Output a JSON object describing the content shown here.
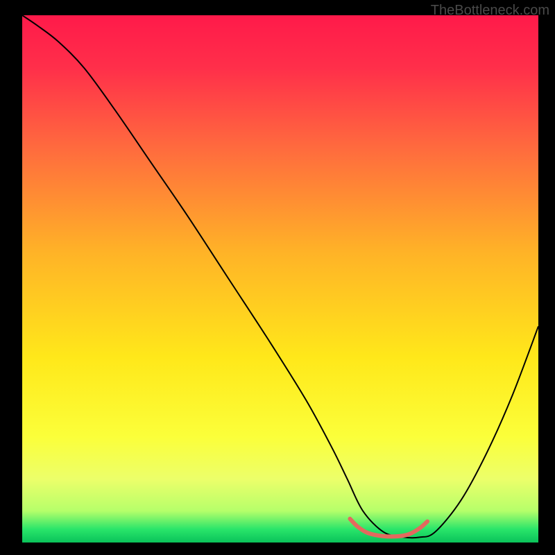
{
  "watermark": "TheBottleneck.com",
  "chart_data": {
    "type": "line",
    "title": "",
    "xlabel": "",
    "ylabel": "",
    "xlim": [
      0,
      100
    ],
    "ylim": [
      0,
      100
    ],
    "grid": false,
    "background_gradient": {
      "stops": [
        {
          "offset": 0.0,
          "color": "#ff1a4a"
        },
        {
          "offset": 0.1,
          "color": "#ff2f4a"
        },
        {
          "offset": 0.25,
          "color": "#ff6a3e"
        },
        {
          "offset": 0.45,
          "color": "#ffb327"
        },
        {
          "offset": 0.65,
          "color": "#ffe81a"
        },
        {
          "offset": 0.8,
          "color": "#fbff3a"
        },
        {
          "offset": 0.88,
          "color": "#ecff6a"
        },
        {
          "offset": 0.94,
          "color": "#b6ff6a"
        },
        {
          "offset": 0.975,
          "color": "#29e56a"
        },
        {
          "offset": 1.0,
          "color": "#0ac25a"
        }
      ]
    },
    "series": [
      {
        "name": "curve",
        "color": "#000000",
        "width": 2,
        "x": [
          0,
          3,
          7,
          12,
          18,
          25,
          32,
          40,
          48,
          55,
          60,
          63,
          66,
          70,
          74,
          77,
          80,
          85,
          90,
          95,
          100
        ],
        "y": [
          100,
          98,
          95,
          90,
          82,
          72,
          62,
          50,
          38,
          27,
          18,
          12,
          6,
          2,
          1,
          1,
          2,
          8,
          17,
          28,
          41
        ]
      },
      {
        "name": "highlight",
        "color": "#e4695e",
        "width": 6,
        "x": [
          63.5,
          65,
          67,
          70,
          73,
          75,
          77,
          78.5
        ],
        "y": [
          4.5,
          3,
          1.8,
          1.2,
          1.2,
          1.6,
          2.7,
          4.0
        ]
      }
    ]
  }
}
